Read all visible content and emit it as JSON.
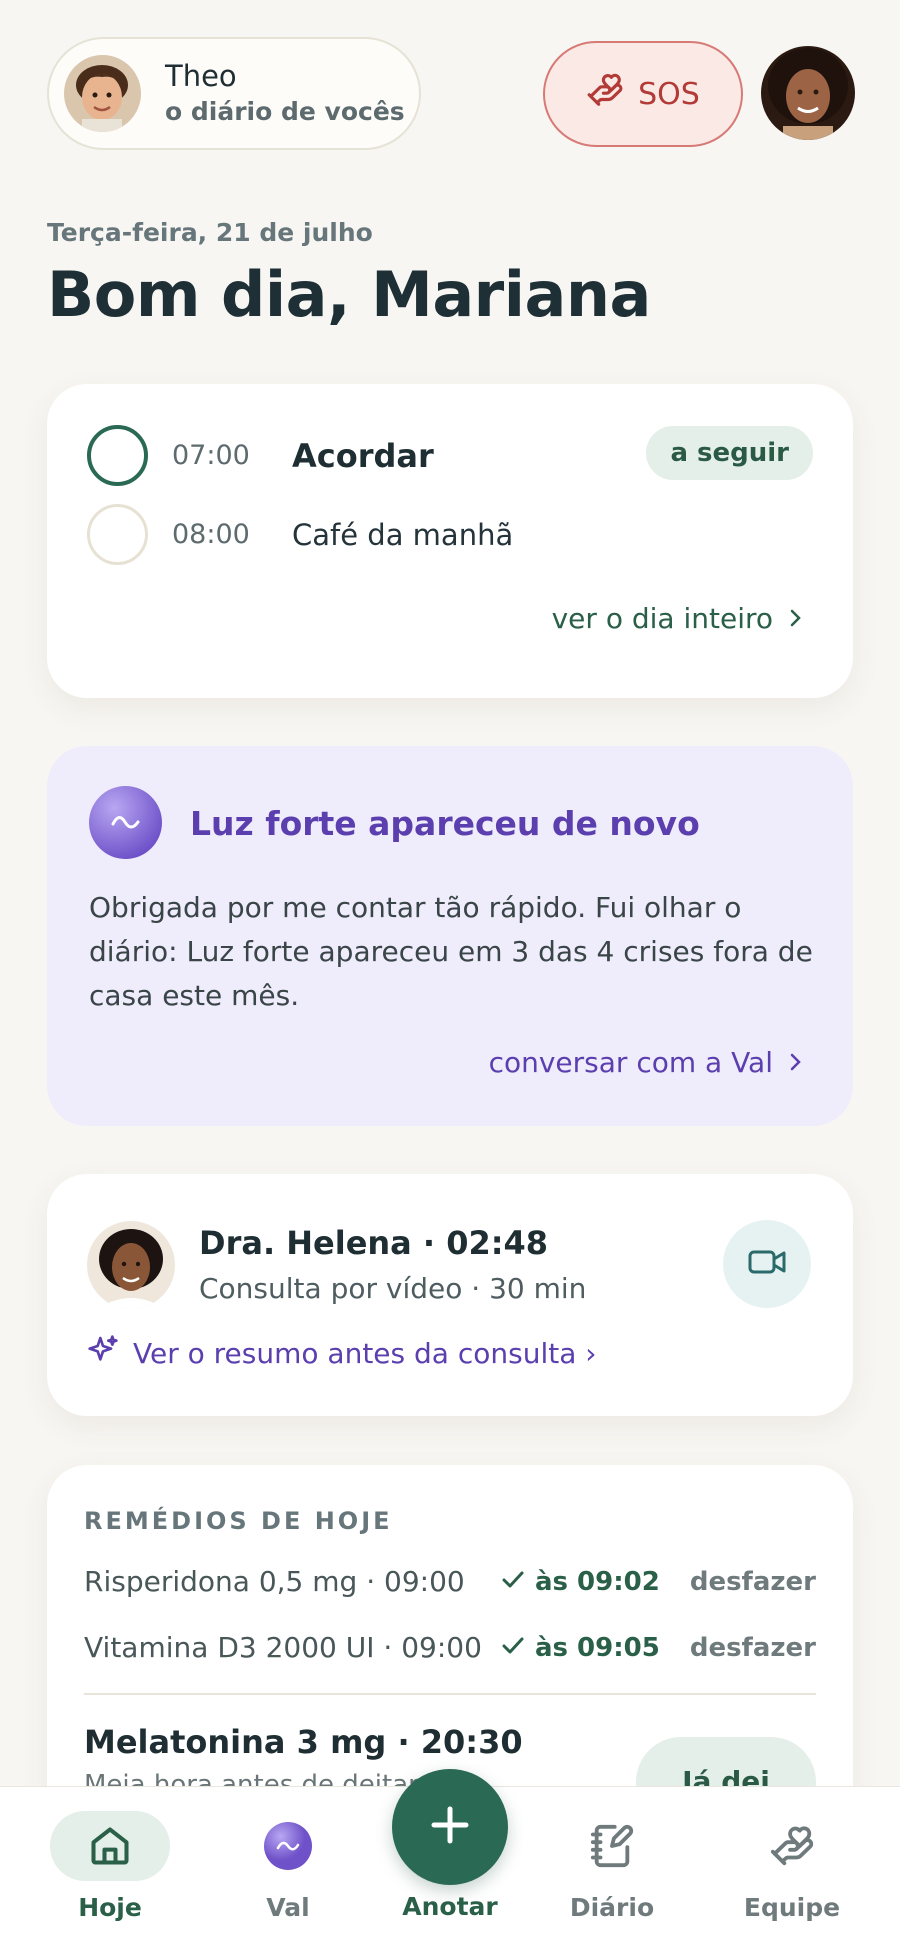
{
  "header": {
    "child_name": "Theo",
    "child_subtitle": "o diário de vocês",
    "sos_label": "SOS"
  },
  "greeting": {
    "date": "Terça-feira, 21 de julho",
    "title": "Bom dia, Mariana"
  },
  "schedule": {
    "items": [
      {
        "time": "07:00",
        "task": "Acordar",
        "badge": "a seguir"
      },
      {
        "time": "08:00",
        "task": "Café da manhã"
      }
    ],
    "see_all": "ver o dia inteiro"
  },
  "val_card": {
    "title": "Luz forte apareceu de novo",
    "body": "Obrigada por me contar tão rápido. Fui olhar o diário: Luz forte apareceu em 3 das 4 crises fora de casa este mês.",
    "link": "conversar com a Val"
  },
  "consult": {
    "doctor": "Dra. Helena · 02:48",
    "subtitle": "Consulta por vídeo · 30 min",
    "summary_link": "Ver o resumo antes da consulta ›"
  },
  "meds": {
    "title": "REMÉDIOS DE HOJE",
    "items": [
      {
        "name": "Risperidona 0,5 mg · 09:00",
        "taken": "às 09:02",
        "undo": "desfazer"
      },
      {
        "name": "Vitamina D3 2000 UI · 09:00",
        "taken": "às 09:05",
        "undo": "desfazer"
      }
    ],
    "next_name": "Melatonina 3 mg · 20:30",
    "next_sub": "Meia hora antes de deitar",
    "next_button": "Já dei"
  },
  "nav": {
    "items": [
      {
        "label": "Hoje",
        "icon": "home-icon"
      },
      {
        "label": "Val",
        "icon": "val-orb-icon"
      },
      {
        "label": "Anotar",
        "icon": "plus-icon"
      },
      {
        "label": "Diário",
        "icon": "journal-icon"
      },
      {
        "label": "Equipe",
        "icon": "team-hand-icon"
      }
    ]
  },
  "colors": {
    "primary_green": "#2a6a55",
    "val_purple": "#5b3fae",
    "sos_red": "#b23a37",
    "background": "#f8f6f2"
  }
}
